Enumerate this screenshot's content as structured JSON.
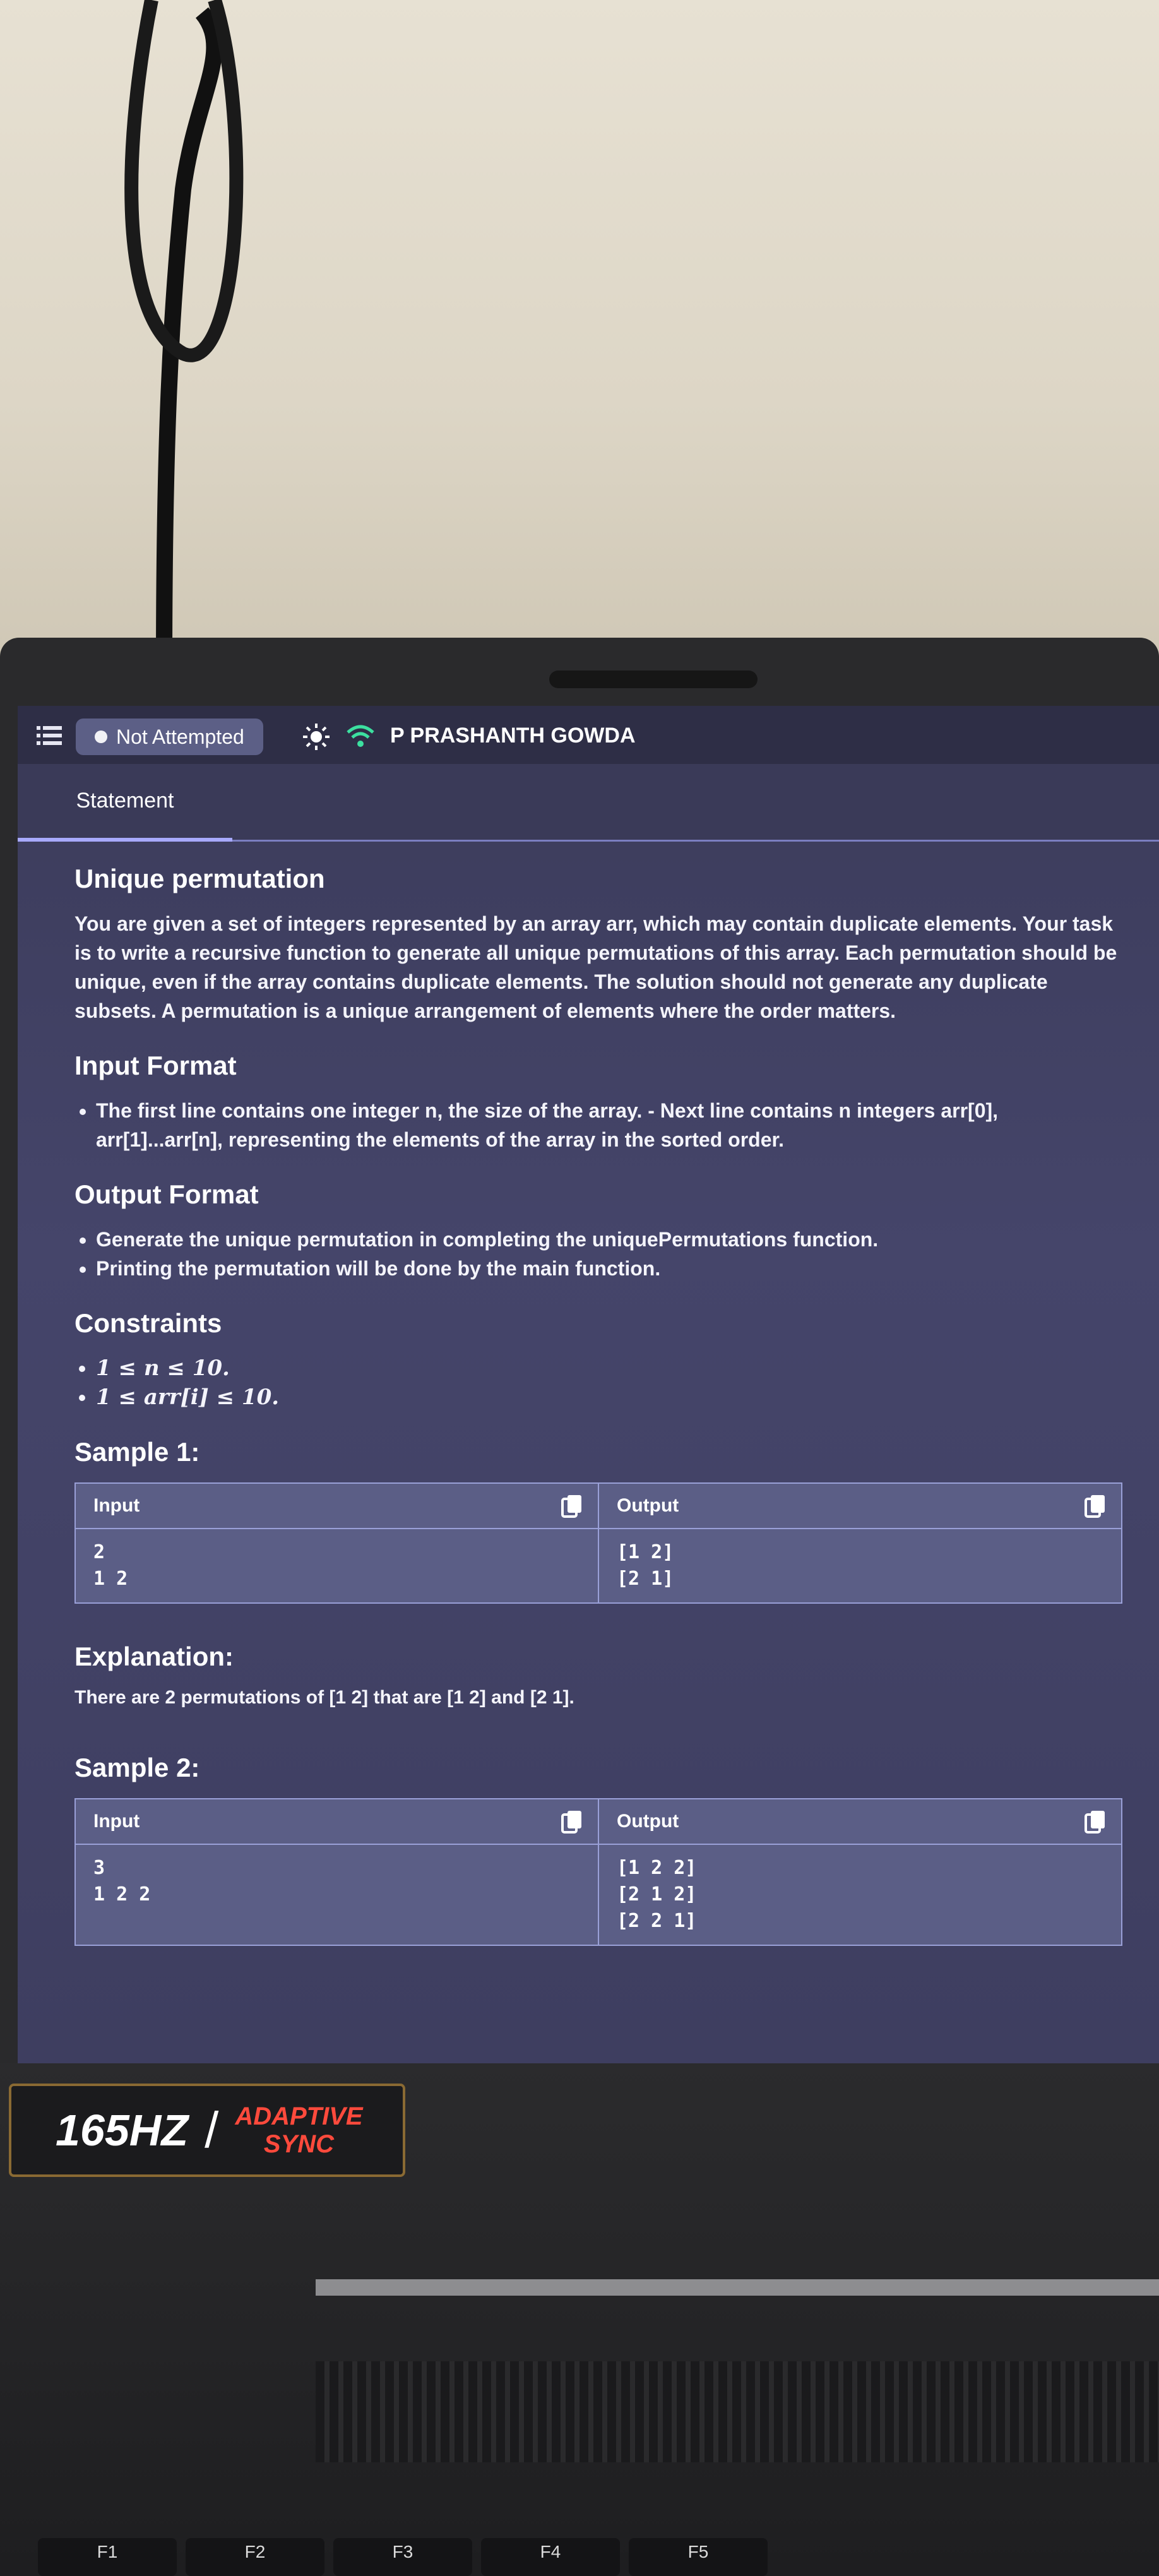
{
  "status": {
    "label": "Not Attempted"
  },
  "user": {
    "name": "P PRASHANTH GOWDA"
  },
  "tabs": [
    {
      "label": "Statement"
    }
  ],
  "problem": {
    "title": "Unique permutation",
    "description": "You are given a set of integers represented by an array arr, which may contain duplicate elements. Your task is to write a recursive function to generate all unique permutations of this array. Each permutation should be unique, even if the array contains duplicate elements. The solution should not generate any duplicate subsets. A permutation is a unique arrangement of elements where the order matters.",
    "input_format": {
      "heading": "Input Format",
      "items": [
        "The first line contains one integer n, the size of the array. - Next line contains n integers arr[0], arr[1]...arr[n], representing the elements of the array in the sorted order."
      ]
    },
    "output_format": {
      "heading": "Output Format",
      "items": [
        "Generate the unique permutation in completing the uniquePermutations function.",
        "Printing the permutation will be done by the main function."
      ]
    },
    "constraints": {
      "heading": "Constraints",
      "items": [
        "1 ≤ n ≤ 10.",
        "1 ≤ arr[i] ≤ 10."
      ]
    },
    "samples": [
      {
        "heading": "Sample 1:",
        "input_label": "Input",
        "output_label": "Output",
        "input_lines": [
          "2",
          "1 2"
        ],
        "output_lines": [
          "[1 2]",
          "[2 1]"
        ],
        "explanation_heading": "Explanation:",
        "explanation": "There are 2 permutations of [1 2] that are [1 2] and [2 1]."
      },
      {
        "heading": "Sample 2:",
        "input_label": "Input",
        "output_label": "Output",
        "input_lines": [
          "3",
          "1 2 2"
        ],
        "output_lines": [
          "[1 2 2]",
          "[2 1 2]",
          "[2 2 1]"
        ]
      }
    ]
  },
  "laptop": {
    "badge_rate": "165HZ",
    "badge_line1": "ADAPTIVE",
    "badge_line2": "SYNC",
    "fkeys": [
      "F1",
      "F2",
      "F3",
      "F4",
      "F5"
    ]
  },
  "colors": {
    "accent": "#a7a9ff",
    "badge_red": "#ff4a3c",
    "wifi": "#3ce0a0"
  }
}
